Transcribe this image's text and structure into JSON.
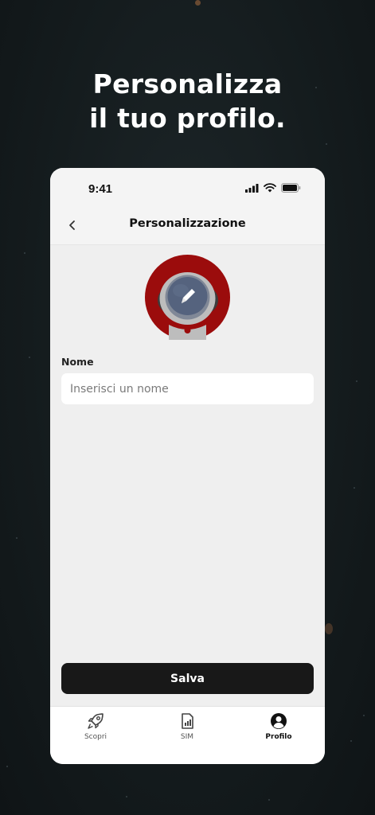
{
  "headline": {
    "line1": "Personalizza",
    "line2": "il tuo profilo."
  },
  "status_bar": {
    "time": "9:41"
  },
  "header": {
    "title": "Personalizzazione"
  },
  "form": {
    "name_label": "Nome",
    "name_placeholder": "Inserisci un nome",
    "name_value": ""
  },
  "save_label": "Salva",
  "tabs": [
    {
      "label": "Scopri",
      "icon": "rocket-icon",
      "active": false
    },
    {
      "label": "SIM",
      "icon": "sim-card-icon",
      "active": false
    },
    {
      "label": "Profilo",
      "icon": "profile-icon",
      "active": true
    }
  ],
  "colors": {
    "avatar_ring": "#9b0c0c",
    "button_bg": "#181818",
    "panel_bg": "#efefef"
  }
}
